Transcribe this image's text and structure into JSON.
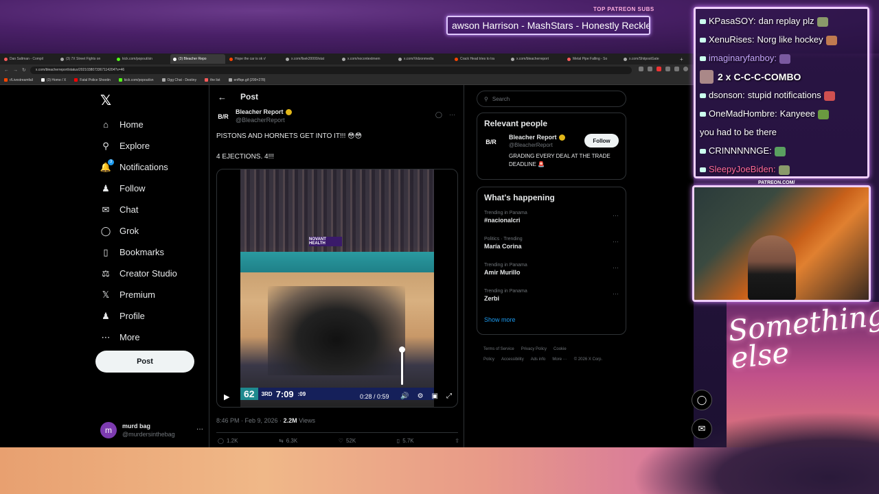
{
  "overlay": {
    "patreon_label": "TOP PATREON SUBS",
    "patreon_ticker": "awson Harrison - MashStars - Honestly Reckle",
    "patreon_url": "PATREON.COM/",
    "logo_text": "Something else"
  },
  "chat": [
    {
      "user": "KPasaSOY:",
      "msg": "dan replay plz",
      "color": "#ffffff"
    },
    {
      "user": "XenuRises:",
      "msg": "Norg like hockey",
      "color": "#ffffff"
    },
    {
      "user": "imaginaryfanboy:",
      "msg": "",
      "color": "#c8a8ff"
    },
    {
      "user": "dsonson:",
      "msg": "stupid notifications",
      "color": "#ffffff"
    },
    {
      "user": "OneMadHombre:",
      "msg": "Kanyeee",
      "color": "#ffffff"
    },
    {
      "user": "",
      "msg": "you had to be there",
      "color": "#ffffff"
    },
    {
      "user": "CRINNNNNGE:",
      "msg": "",
      "color": "#ffffff"
    },
    {
      "user": "SleepyJoeBiden:",
      "msg": "",
      "color": "#ff6a9a"
    }
  ],
  "chat_combo": {
    "count": "2 x",
    "text": "C-C-C-COMBO"
  },
  "browser": {
    "tabs": [
      {
        "label": "Dan Saltman - Compil",
        "color": "#ff5a5a"
      },
      {
        "label": "(3) 7X Street Fights on",
        "color": "#aaa"
      },
      {
        "label": "kick.com/popout/sin",
        "color": "#53fc18"
      },
      {
        "label": "(3) Bleacher Repo",
        "color": "#fff"
      },
      {
        "label": "Hope the car is ok r/",
        "color": "#ff4500"
      },
      {
        "label": "x.com/llsek20000/stat",
        "color": "#aaa"
      },
      {
        "label": "x.com/nocontextmem",
        "color": "#aaa"
      },
      {
        "label": "x.com/Vidzonmedia",
        "color": "#aaa"
      },
      {
        "label": "Crack Head tries to tra",
        "color": "#ff4500"
      },
      {
        "label": "x.com/bleacherreport",
        "color": "#aaa"
      },
      {
        "label": "Metal Pipe Falling - So",
        "color": "#ff5a5a"
      },
      {
        "label": "x.com/ShitpostGate",
        "color": "#aaa"
      }
    ],
    "url": "x.com/bleacherreport/status/2021038073367114204?s=46",
    "bookmarks": [
      {
        "label": "r/Livestreamfail",
        "color": "#ff4500"
      },
      {
        "label": "(3) Home / X",
        "color": "#fff"
      },
      {
        "label": "Fatal Police Shootin",
        "color": "#ff0000"
      },
      {
        "label": "kick.com/popout/sn",
        "color": "#53fc18"
      },
      {
        "label": "Ogg Chat - Destiny",
        "color": "#aaa"
      },
      {
        "label": "the list",
        "color": "#ff5a5a"
      },
      {
        "label": "enffiqe.gif (299×278)",
        "color": "#aaa"
      }
    ]
  },
  "sidebar": {
    "items": [
      {
        "label": "Home",
        "icon": "home-icon"
      },
      {
        "label": "Explore",
        "icon": "search-icon"
      },
      {
        "label": "Notifications",
        "icon": "bell-icon",
        "badge": "3"
      },
      {
        "label": "Follow",
        "icon": "person-add-icon"
      },
      {
        "label": "Chat",
        "icon": "mail-icon"
      },
      {
        "label": "Grok",
        "icon": "grok-icon"
      },
      {
        "label": "Bookmarks",
        "icon": "bookmark-icon"
      },
      {
        "label": "Creator Studio",
        "icon": "flask-icon"
      },
      {
        "label": "Premium",
        "icon": "x-icon"
      },
      {
        "label": "Profile",
        "icon": "person-icon"
      },
      {
        "label": "More",
        "icon": "more-circle-icon"
      }
    ],
    "post_label": "Post",
    "account": {
      "initial": "m",
      "name": "murd bag",
      "handle": "@murdersinthebag"
    }
  },
  "main": {
    "title": "Post",
    "tweet": {
      "author": "Bleacher Report",
      "handle": "@BleacherReport",
      "logo": "B/R",
      "line1": "PISTONS AND HORNETS GET INTO IT!!! 😳😳",
      "line2": "4 EJECTIONS. 4!!!",
      "sponsor": "NOVANT HEALTH",
      "score": "62",
      "quarter": "3RD",
      "game_clock": "7:09",
      "shot_clock": ":09",
      "time": "0:28 / 0:59",
      "timestamp": "8:46 PM · Feb 9, 2026 ·",
      "views": "2.2M",
      "views_label": "Views",
      "replies": "1.2K",
      "reposts": "6.3K",
      "likes": "52K",
      "bookmarks": "5.7K"
    }
  },
  "right": {
    "search_placeholder": "Search",
    "relevant_title": "Relevant people",
    "person": {
      "logo": "B/R",
      "name": "Bleacher Report",
      "handle": "@BleacherReport",
      "bio": "GRADING EVERY DEAL AT THE TRADE DEADLINE 🚨",
      "follow": "Follow"
    },
    "happening_title": "What's happening",
    "trends": [
      {
        "context": "Trending in Panama",
        "name": "#nacionalcri"
      },
      {
        "context": "Politics · Trending",
        "name": "María Corina"
      },
      {
        "context": "Trending in Panama",
        "name": "Amir Murillo"
      },
      {
        "context": "Trending in Panama",
        "name": "Zerbi"
      }
    ],
    "show_more": "Show more",
    "footer": [
      "Terms of Service",
      "Privacy Policy",
      "Cookie Policy",
      "Accessibility",
      "Ads info",
      "More ···",
      "© 2026 X Corp."
    ]
  }
}
